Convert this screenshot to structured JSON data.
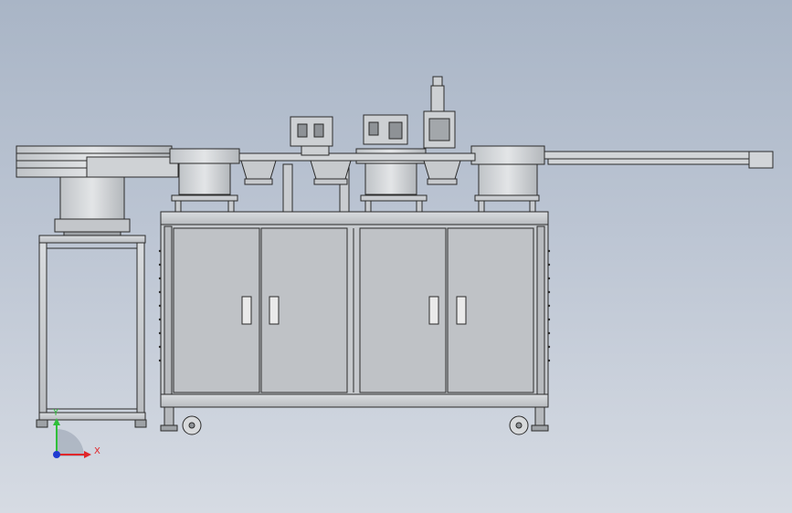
{
  "viewport": {
    "background_top": "#a9b5c6",
    "background_bottom": "#d6dbe3"
  },
  "triad": {
    "x_label": "X",
    "y_label": "Y",
    "x_color": "#e0262a",
    "y_color": "#2fbf3a",
    "z_color": "#1f3bd1"
  },
  "machine": {
    "frame_color": "#c9ccd0",
    "panel_color": "#bfc2c6",
    "line_color": "#2b2b2b",
    "cabinet_doors": 4,
    "bowl_feeders": 4
  }
}
